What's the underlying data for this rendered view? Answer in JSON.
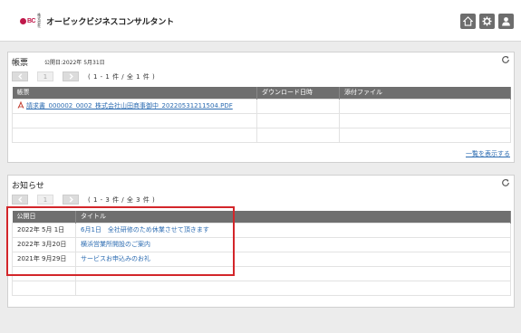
{
  "header": {
    "logo_mark": "OBC",
    "logo_kk": "株式会社",
    "company_name": "オービックビジネスコンサルタント",
    "icons": [
      "home-icon",
      "gear-icon",
      "user-icon"
    ]
  },
  "forms_panel": {
    "title": "帳票",
    "public_date": "公開日:2022年 5月31日",
    "pager": {
      "page": "1",
      "info": "( 1 - 1 件 / 全 1 件 )"
    },
    "columns": [
      "帳票",
      "ダウンロード日時",
      "添付ファイル"
    ],
    "rows": [
      {
        "file": "請求書_000002_0002_株式会社山田商事御中_20220531211504.PDF",
        "download": "",
        "attachment": ""
      }
    ],
    "show_all_link": "一覧を表示する"
  },
  "notice_panel": {
    "title": "お知らせ",
    "pager": {
      "page": "1",
      "info": "( 1 - 3 件 / 全 3 件 )"
    },
    "columns": [
      "公開日",
      "タイトル"
    ],
    "rows": [
      {
        "date": "2022年 5月 1日",
        "title": "6月1日　全社研修のため休業させて頂きます"
      },
      {
        "date": "2022年 3月20日",
        "title": "横浜営業所開設のご案内"
      },
      {
        "date": "2021年 9月29日",
        "title": "サービスお申込みのお礼"
      }
    ]
  },
  "colors": {
    "highlight": "#d3262a",
    "link": "#2b6bb1",
    "table_header": "#6f6f6f"
  }
}
